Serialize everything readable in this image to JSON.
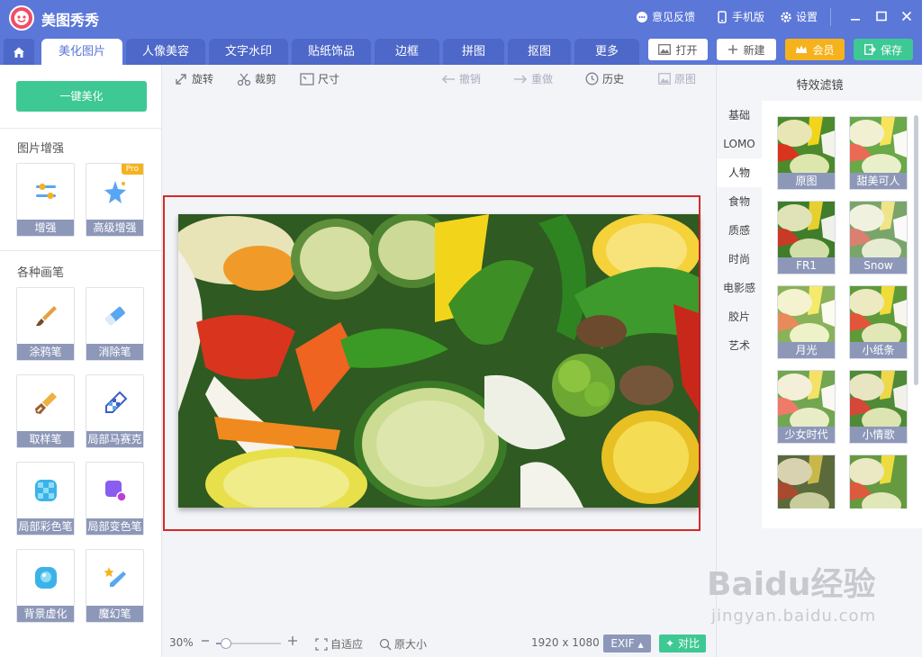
{
  "app": {
    "title": "美图秀秀"
  },
  "titlebar": {
    "feedback": "意见反馈",
    "mobile": "手机版",
    "settings": "设置"
  },
  "tabs": [
    "美化图片",
    "人像美容",
    "文字水印",
    "贴纸饰品",
    "边框",
    "拼图",
    "抠图",
    "更多"
  ],
  "actions": {
    "open": "打开",
    "new": "新建",
    "vip": "会员",
    "save": "保存"
  },
  "left": {
    "one_click": "一键美化",
    "enhance_title": "图片增强",
    "enhance_tools": [
      "增强",
      "高级增强"
    ],
    "pro_badge": "Pro",
    "brush_title": "各种画笔",
    "brush_tools": [
      "涂鸦笔",
      "消除笔",
      "取样笔",
      "局部马赛克",
      "局部彩色笔",
      "局部变色笔",
      "背景虚化",
      "魔幻笔"
    ]
  },
  "edit_tools": {
    "rotate": "旋转",
    "crop": "裁剪",
    "size": "尺寸",
    "undo": "撤销",
    "redo": "重做",
    "history": "历史",
    "original": "原图"
  },
  "status": {
    "zoom": "30%",
    "zoom_level": 0.3,
    "fit": "自适应",
    "actual": "原大小",
    "dimensions": "1920 x 1080",
    "exif": "EXIF",
    "compare": "对比"
  },
  "right": {
    "title": "特效滤镜",
    "categories": [
      "基础",
      "LOMO",
      "人物",
      "食物",
      "质感",
      "时尚",
      "电影感",
      "胶片",
      "艺术"
    ],
    "active_category": "人物",
    "filters": [
      "原图",
      "甜美可人",
      "FR1",
      "Snow",
      "月光",
      "小纸条",
      "少女时代",
      "小情歌"
    ]
  },
  "watermark": {
    "line1": "Baidu经验",
    "line2": "jingyan.baidu.com"
  },
  "colors": {
    "brand": "#5b77d8",
    "accent": "#3ec894",
    "vip": "#f6b21d",
    "label": "#8d98b9",
    "selection": "#d52a2a"
  }
}
